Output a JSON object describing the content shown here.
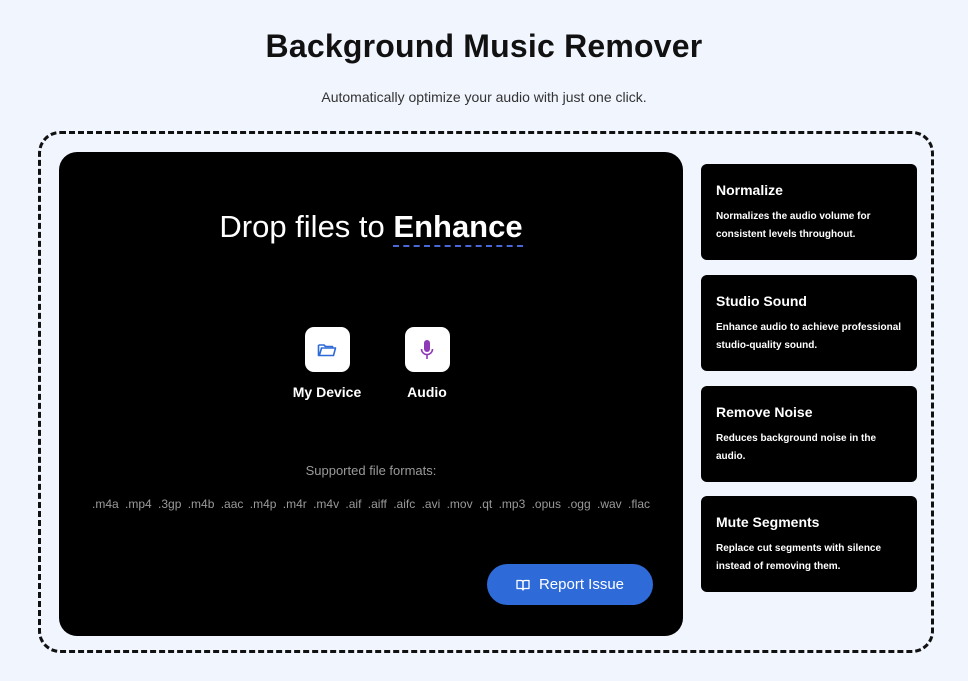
{
  "header": {
    "title": "Background Music Remover",
    "subtitle": "Automatically optimize your audio with just one click."
  },
  "dropzone": {
    "heading_prefix": "Drop files to ",
    "heading_accent": "Enhance",
    "sources": [
      {
        "label": "My Device",
        "icon": "folder-icon"
      },
      {
        "label": "Audio",
        "icon": "microphone-icon"
      }
    ],
    "formats_label": "Supported file formats:",
    "formats": ".m4a .mp4 .3gp .m4b .aac .m4p .m4r .m4v .aif .aiff .aifc .avi .mov .qt .mp3 .opus .ogg .wav .flac",
    "report_label": "Report Issue",
    "report_icon": "book-icon"
  },
  "features": [
    {
      "title": "Normalize",
      "desc": "Normalizes the audio volume for consistent levels throughout."
    },
    {
      "title": "Studio Sound",
      "desc": "Enhance audio to achieve professional studio-quality sound."
    },
    {
      "title": "Remove Noise",
      "desc": "Reduces background noise in the audio."
    },
    {
      "title": "Mute Segments",
      "desc": "Replace cut segments with silence instead of removing them."
    }
  ],
  "colors": {
    "background": "#f1f5fe",
    "panel": "#000000",
    "accent_button": "#2e6bd8",
    "folder_icon": "#2e6bd8",
    "mic_icon": "#8e3ab8"
  }
}
